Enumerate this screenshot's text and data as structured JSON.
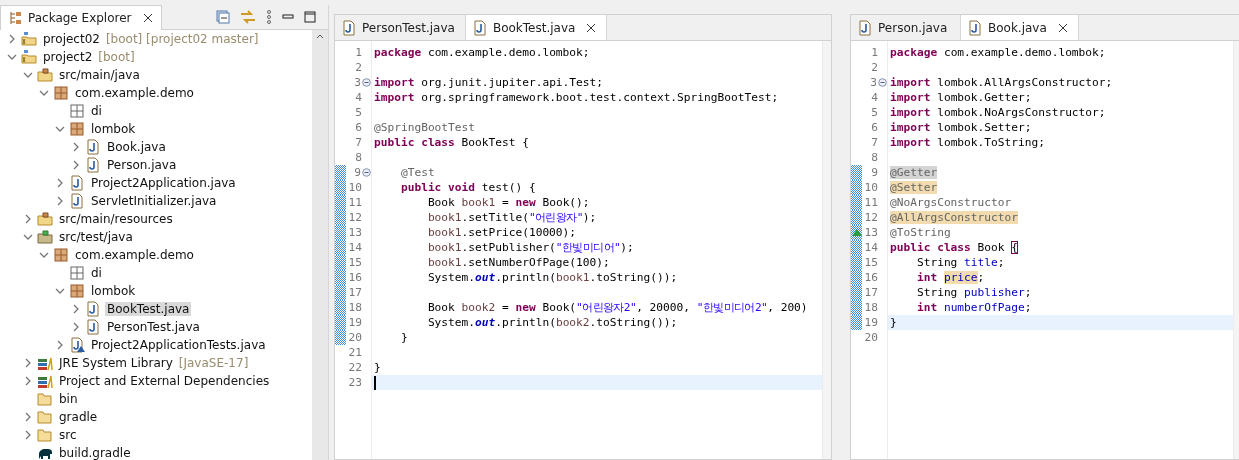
{
  "explorer": {
    "title": "Package Explorer",
    "tree": [
      {
        "label": "project02",
        "decoration": "[boot] [project02 master]",
        "kind": "project",
        "expanded": false,
        "selected": false
      },
      {
        "label": "project2",
        "decoration": "[boot]",
        "kind": "project",
        "expanded": true,
        "selected": false,
        "children": [
          {
            "label": "src/main/java",
            "kind": "source-folder",
            "expanded": true,
            "selected": false,
            "children": [
              {
                "label": "com.example.demo",
                "kind": "package",
                "expanded": true,
                "selected": false,
                "children": [
                  {
                    "label": "di",
                    "kind": "empty-package",
                    "selected": false
                  },
                  {
                    "label": "lombok",
                    "kind": "package",
                    "expanded": true,
                    "selected": false,
                    "children": [
                      {
                        "label": "Book.java",
                        "kind": "java-file",
                        "expanded": false,
                        "selected": false
                      },
                      {
                        "label": "Person.java",
                        "kind": "java-file",
                        "expanded": false,
                        "selected": false
                      }
                    ]
                  },
                  {
                    "label": "Project2Application.java",
                    "kind": "java-file",
                    "expanded": false,
                    "selected": false
                  },
                  {
                    "label": "ServletInitializer.java",
                    "kind": "java-file",
                    "expanded": false,
                    "selected": false
                  }
                ]
              }
            ]
          },
          {
            "label": "src/main/resources",
            "kind": "source-folder",
            "expanded": false,
            "selected": false
          },
          {
            "label": "src/test/java",
            "kind": "test-folder",
            "expanded": true,
            "selected": false,
            "children": [
              {
                "label": "com.example.demo",
                "kind": "package",
                "expanded": true,
                "selected": false,
                "children": [
                  {
                    "label": "di",
                    "kind": "empty-package",
                    "selected": false
                  },
                  {
                    "label": "lombok",
                    "kind": "package",
                    "expanded": true,
                    "selected": false,
                    "children": [
                      {
                        "label": "BookTest.java",
                        "kind": "java-file",
                        "expanded": false,
                        "selected": true
                      },
                      {
                        "label": "PersonTest.java",
                        "kind": "java-file",
                        "expanded": false,
                        "selected": false
                      }
                    ]
                  },
                  {
                    "label": "Project2ApplicationTests.java",
                    "kind": "test-java-file",
                    "expanded": false,
                    "selected": false
                  }
                ]
              }
            ]
          },
          {
            "label": "JRE System Library",
            "decoration": "[JavaSE-17]",
            "kind": "library",
            "expanded": false,
            "selected": false
          },
          {
            "label": "Project and External Dependencies",
            "kind": "library",
            "expanded": false,
            "selected": false
          },
          {
            "label": "bin",
            "kind": "folder",
            "selected": false
          },
          {
            "label": "gradle",
            "kind": "folder",
            "expanded": false,
            "selected": false
          },
          {
            "label": "src",
            "kind": "folder",
            "expanded": false,
            "selected": false
          },
          {
            "label": "build.gradle",
            "kind": "gradle-file",
            "selected": false
          }
        ]
      }
    ]
  },
  "editors": [
    {
      "tabs": [
        {
          "label": "PersonTest.java",
          "selected": false
        },
        {
          "label": "BookTest.java",
          "selected": true
        }
      ],
      "lines": [
        {
          "number": "1",
          "changed": false,
          "current": false,
          "fold": false,
          "tokens": [
            {
              "text": "package",
              "kind": "keyword"
            },
            {
              "text": " com.example.demo.lombok;",
              "kind": "plain"
            }
          ]
        },
        {
          "number": "2",
          "changed": false,
          "current": false,
          "fold": false
        },
        {
          "number": "3",
          "changed": false,
          "current": false,
          "fold": true,
          "tokens": [
            {
              "text": "import",
              "kind": "keyword"
            },
            {
              "text": " org.junit.jupiter.api.Test;",
              "kind": "plain"
            }
          ]
        },
        {
          "number": "4",
          "changed": false,
          "current": false,
          "fold": false,
          "tokens": [
            {
              "text": "import",
              "kind": "keyword"
            },
            {
              "text": " org.springframework.boot.test.context.SpringBootTest;",
              "kind": "plain"
            }
          ]
        },
        {
          "number": "5",
          "changed": false,
          "current": false,
          "fold": false
        },
        {
          "number": "6",
          "changed": false,
          "current": false,
          "fold": false,
          "tokens": [
            {
              "text": "@SpringBootTest",
              "kind": "annotation"
            }
          ]
        },
        {
          "number": "7",
          "changed": false,
          "current": false,
          "fold": false,
          "tokens": [
            {
              "text": "public class",
              "kind": "keyword"
            },
            {
              "text": " BookTest {",
              "kind": "plain"
            }
          ]
        },
        {
          "number": "8",
          "changed": false,
          "current": false,
          "fold": false
        },
        {
          "number": "9",
          "changed": true,
          "current": false,
          "fold": true,
          "tokens": [
            {
              "text": "    @Test",
              "kind": "annotation"
            }
          ]
        },
        {
          "number": "10",
          "changed": true,
          "current": false,
          "fold": false,
          "tokens": [
            {
              "text": "    public void",
              "kind": "keyword"
            },
            {
              "text": " test() {",
              "kind": "plain"
            }
          ]
        },
        {
          "number": "11",
          "changed": true,
          "current": false,
          "fold": false,
          "tokens": [
            {
              "text": "        Book ",
              "kind": "plain"
            },
            {
              "text": "book1",
              "kind": "local"
            },
            {
              "text": " = ",
              "kind": "plain"
            },
            {
              "text": "new",
              "kind": "keyword"
            },
            {
              "text": " Book();",
              "kind": "plain"
            }
          ]
        },
        {
          "number": "12",
          "changed": true,
          "current": false,
          "fold": false,
          "tokens": [
            {
              "text": "        book1",
              "kind": "local"
            },
            {
              "text": ".setTitle(",
              "kind": "plain"
            },
            {
              "text": "\"어린왕자\"",
              "kind": "string"
            },
            {
              "text": ");",
              "kind": "plain"
            }
          ]
        },
        {
          "number": "13",
          "changed": true,
          "current": false,
          "fold": false,
          "tokens": [
            {
              "text": "        book1",
              "kind": "local"
            },
            {
              "text": ".setPrice(10000);",
              "kind": "plain"
            }
          ]
        },
        {
          "number": "14",
          "changed": true,
          "current": false,
          "fold": false,
          "tokens": [
            {
              "text": "        book1",
              "kind": "local"
            },
            {
              "text": ".setPublisher(",
              "kind": "plain"
            },
            {
              "text": "\"한빛미디어\"",
              "kind": "string"
            },
            {
              "text": ");",
              "kind": "plain"
            }
          ]
        },
        {
          "number": "15",
          "changed": true,
          "current": false,
          "fold": false,
          "tokens": [
            {
              "text": "        book1",
              "kind": "local"
            },
            {
              "text": ".setNumberOfPage(100);",
              "kind": "plain"
            }
          ]
        },
        {
          "number": "16",
          "changed": true,
          "current": false,
          "fold": false,
          "tokens": [
            {
              "text": "        System.",
              "kind": "plain"
            },
            {
              "text": "out",
              "kind": "static"
            },
            {
              "text": ".println(",
              "kind": "plain"
            },
            {
              "text": "book1",
              "kind": "local"
            },
            {
              "text": ".toString());",
              "kind": "plain"
            }
          ]
        },
        {
          "number": "17",
          "changed": true,
          "current": false,
          "fold": false
        },
        {
          "number": "18",
          "changed": true,
          "current": false,
          "fold": false,
          "tokens": [
            {
              "text": "        Book ",
              "kind": "plain"
            },
            {
              "text": "book2",
              "kind": "local"
            },
            {
              "text": " = ",
              "kind": "plain"
            },
            {
              "text": "new",
              "kind": "keyword"
            },
            {
              "text": " Book(",
              "kind": "plain"
            },
            {
              "text": "\"어린왕자2\"",
              "kind": "string"
            },
            {
              "text": ", 20000, ",
              "kind": "plain"
            },
            {
              "text": "\"한빛미디어2\"",
              "kind": "string"
            },
            {
              "text": ", 200)",
              "kind": "plain"
            }
          ]
        },
        {
          "number": "19",
          "changed": true,
          "current": false,
          "fold": false,
          "tokens": [
            {
              "text": "        System.",
              "kind": "plain"
            },
            {
              "text": "out",
              "kind": "static"
            },
            {
              "text": ".println(",
              "kind": "plain"
            },
            {
              "text": "book2",
              "kind": "local"
            },
            {
              "text": ".toString());",
              "kind": "plain"
            }
          ]
        },
        {
          "number": "20",
          "changed": true,
          "current": false,
          "fold": false,
          "tokens": [
            {
              "text": "    }",
              "kind": "plain"
            }
          ]
        },
        {
          "number": "21",
          "changed": false,
          "current": false,
          "fold": false
        },
        {
          "number": "22",
          "changed": false,
          "current": false,
          "fold": false,
          "tokens": [
            {
              "text": "}",
              "kind": "plain"
            }
          ]
        },
        {
          "number": "23",
          "changed": false,
          "current": true,
          "fold": false
        }
      ]
    },
    {
      "tabs": [
        {
          "label": "Person.java",
          "selected": false
        },
        {
          "label": "Book.java",
          "selected": true
        }
      ],
      "lines": [
        {
          "number": "1",
          "changed": false,
          "current": false,
          "fold": false,
          "tokens": [
            {
              "text": "package",
              "kind": "keyword"
            },
            {
              "text": " com.example.demo.lombok;",
              "kind": "plain"
            }
          ]
        },
        {
          "number": "2",
          "changed": false,
          "current": false,
          "fold": false
        },
        {
          "number": "3",
          "changed": false,
          "current": false,
          "fold": true,
          "tokens": [
            {
              "text": "import",
              "kind": "keyword"
            },
            {
              "text": " lombok.AllArgsConstructor;",
              "kind": "plain"
            }
          ]
        },
        {
          "number": "4",
          "changed": false,
          "current": false,
          "fold": false,
          "tokens": [
            {
              "text": "import",
              "kind": "keyword"
            },
            {
              "text": " lombok.Getter;",
              "kind": "plain"
            }
          ]
        },
        {
          "number": "5",
          "changed": false,
          "current": false,
          "fold": false,
          "tokens": [
            {
              "text": "import",
              "kind": "keyword"
            },
            {
              "text": " lombok.NoArgsConstructor;",
              "kind": "plain"
            }
          ]
        },
        {
          "number": "6",
          "changed": false,
          "current": false,
          "fold": false,
          "tokens": [
            {
              "text": "import",
              "kind": "keyword"
            },
            {
              "text": " lombok.Setter;",
              "kind": "plain"
            }
          ]
        },
        {
          "number": "7",
          "changed": false,
          "current": false,
          "fold": false,
          "tokens": [
            {
              "text": "import",
              "kind": "keyword"
            },
            {
              "text": " lombok.ToString;",
              "kind": "plain"
            }
          ]
        },
        {
          "number": "8",
          "changed": false,
          "current": false,
          "fold": false
        },
        {
          "number": "9",
          "changed": true,
          "current": false,
          "fold": false,
          "tokens": [
            {
              "text": "@Getter",
              "kind": "annotation",
              "selected": true
            }
          ]
        },
        {
          "number": "10",
          "changed": true,
          "current": false,
          "fold": false,
          "tokens": [
            {
              "text": "@Setter",
              "kind": "annotation",
              "highlighted": true
            }
          ]
        },
        {
          "number": "11",
          "changed": true,
          "current": false,
          "fold": false,
          "tokens": [
            {
              "text": "@NoArgsConstructor",
              "kind": "annotation"
            }
          ]
        },
        {
          "number": "12",
          "changed": true,
          "current": false,
          "fold": false,
          "tokens": [
            {
              "text": "@AllArgsConstructor",
              "kind": "annotation",
              "highlighted": true
            }
          ]
        },
        {
          "number": "13",
          "changed": true,
          "current": false,
          "fold": false,
          "override_marker": true,
          "tokens": [
            {
              "text": "@ToString",
              "kind": "annotation"
            }
          ]
        },
        {
          "number": "14",
          "changed": true,
          "current": false,
          "fold": false,
          "tokens": [
            {
              "text": "public class",
              "kind": "keyword"
            },
            {
              "text": " Book ",
              "kind": "plain"
            },
            {
              "text": "{",
              "kind": "plain",
              "bracket_match": true
            }
          ]
        },
        {
          "number": "15",
          "changed": true,
          "current": false,
          "fold": false,
          "tokens": [
            {
              "text": "    String ",
              "kind": "plain"
            },
            {
              "text": "title",
              "kind": "field"
            },
            {
              "text": ";",
              "kind": "plain"
            }
          ]
        },
        {
          "number": "16",
          "changed": true,
          "current": false,
          "fold": false,
          "tokens": [
            {
              "text": "    int ",
              "kind": "keyword"
            },
            {
              "text": "price",
              "kind": "field",
              "highlighted": true
            },
            {
              "text": ";",
              "kind": "plain"
            }
          ]
        },
        {
          "number": "17",
          "changed": true,
          "current": false,
          "fold": false,
          "tokens": [
            {
              "text": "    String ",
              "kind": "plain"
            },
            {
              "text": "publisher",
              "kind": "field"
            },
            {
              "text": ";",
              "kind": "plain"
            }
          ]
        },
        {
          "number": "18",
          "changed": true,
          "current": false,
          "fold": false,
          "tokens": [
            {
              "text": "    int ",
              "kind": "keyword"
            },
            {
              "text": "numberOfPage",
              "kind": "field"
            },
            {
              "text": ";",
              "kind": "plain"
            }
          ]
        },
        {
          "number": "19",
          "changed": true,
          "current": true,
          "fold": false,
          "tokens": [
            {
              "text": "}",
              "kind": "plain"
            }
          ]
        },
        {
          "number": "20",
          "changed": false,
          "current": false,
          "fold": false
        }
      ]
    }
  ]
}
